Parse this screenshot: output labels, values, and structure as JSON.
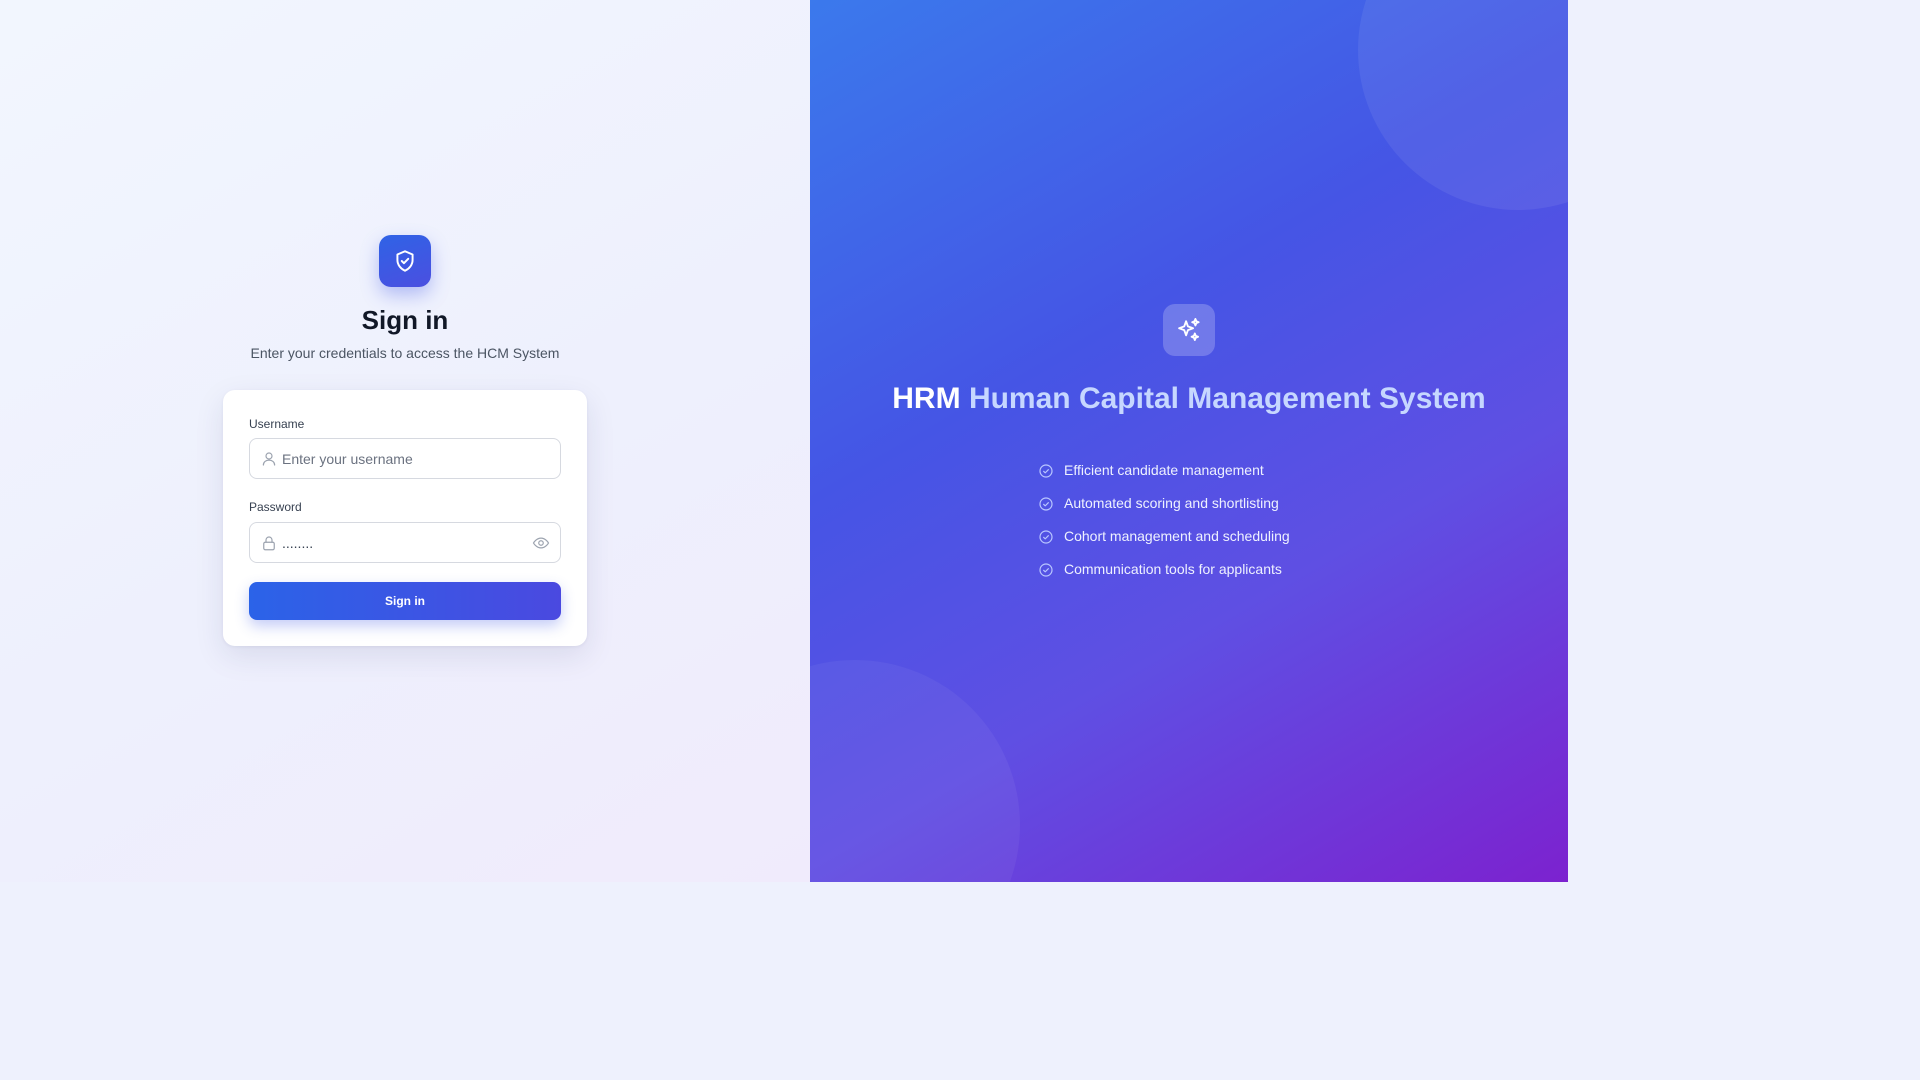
{
  "login": {
    "title": "Sign in",
    "subtitle": "Enter your credentials to access the HCM System",
    "username_label": "Username",
    "username_placeholder": "Enter your username",
    "password_label": "Password",
    "password_value": "........",
    "submit_label": "Sign in"
  },
  "hero": {
    "brand": "HRM",
    "title": "Human Capital Management System",
    "features": [
      "Efficient candidate management",
      "Automated scoring and shortlisting",
      "Cohort management and scheduling",
      "Communication tools for applicants"
    ]
  },
  "icons": {
    "logo": "shield-check-icon",
    "hero": "sparkles-icon",
    "username": "user-icon",
    "password": "lock-icon",
    "toggle": "eye-icon",
    "feature": "check-circle-icon"
  },
  "colors": {
    "primary": "#2b63e8",
    "accent": "#4a49e0",
    "hero_start": "#3b79ec",
    "hero_end": "#7c22cf"
  }
}
